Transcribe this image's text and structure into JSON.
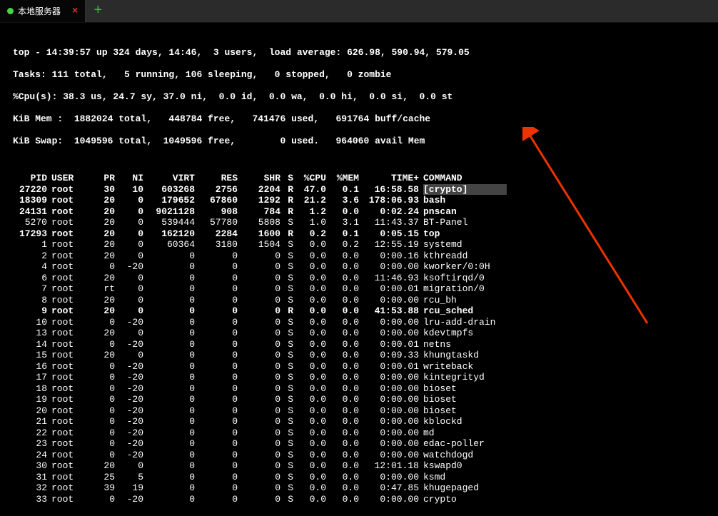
{
  "tab": {
    "title": "本地服务器",
    "close": "×",
    "add": "+"
  },
  "header": {
    "l1": "top - 14:39:57 up 324 days, 14:46,  3 users,  load average: 626.98, 590.94, 579.05",
    "l2": "Tasks: 111 total,   5 running, 106 sleeping,   0 stopped,   0 zombie",
    "l3": "%Cpu(s): 38.3 us, 24.7 sy, 37.0 ni,  0.0 id,  0.0 wa,  0.0 hi,  0.0 si,  0.0 st",
    "l4": "KiB Mem :  1882024 total,   448784 free,   741476 used,   691764 buff/cache",
    "l5": "KiB Swap:  1049596 total,  1049596 free,        0 used.   964060 avail Mem"
  },
  "cols": {
    "pid": "PID",
    "user": "USER",
    "pr": "PR",
    "ni": "NI",
    "virt": "VIRT",
    "res": "RES",
    "shr": "SHR",
    "s": "S",
    "cpu": "%CPU",
    "mem": "%MEM",
    "time": "TIME+",
    "cmd": "COMMAND"
  },
  "rows": [
    {
      "b": 1,
      "pid": "27220",
      "user": "root",
      "pr": "30",
      "ni": "10",
      "virt": "603268",
      "res": "2756",
      "shr": "2204",
      "s": "R",
      "cpu": "47.0",
      "mem": "0.1",
      "time": "16:58.58",
      "cmd": "[crypto]",
      "hl": 1
    },
    {
      "b": 1,
      "pid": "18309",
      "user": "root",
      "pr": "20",
      "ni": "0",
      "virt": "179652",
      "res": "67860",
      "shr": "1292",
      "s": "R",
      "cpu": "21.2",
      "mem": "3.6",
      "time": "178:06.93",
      "cmd": "bash"
    },
    {
      "b": 1,
      "pid": "24131",
      "user": "root",
      "pr": "20",
      "ni": "0",
      "virt": "9021128",
      "res": "908",
      "shr": "784",
      "s": "R",
      "cpu": "1.2",
      "mem": "0.0",
      "time": "0:02.24",
      "cmd": "pnscan"
    },
    {
      "b": 0,
      "pid": "5270",
      "user": "root",
      "pr": "20",
      "ni": "0",
      "virt": "539444",
      "res": "57780",
      "shr": "5808",
      "s": "S",
      "cpu": "1.0",
      "mem": "3.1",
      "time": "11:43.37",
      "cmd": "BT-Panel"
    },
    {
      "b": 1,
      "pid": "17293",
      "user": "root",
      "pr": "20",
      "ni": "0",
      "virt": "162120",
      "res": "2284",
      "shr": "1600",
      "s": "R",
      "cpu": "0.2",
      "mem": "0.1",
      "time": "0:05.15",
      "cmd": "top"
    },
    {
      "b": 0,
      "pid": "1",
      "user": "root",
      "pr": "20",
      "ni": "0",
      "virt": "60364",
      "res": "3180",
      "shr": "1504",
      "s": "S",
      "cpu": "0.0",
      "mem": "0.2",
      "time": "12:55.19",
      "cmd": "systemd"
    },
    {
      "b": 0,
      "pid": "2",
      "user": "root",
      "pr": "20",
      "ni": "0",
      "virt": "0",
      "res": "0",
      "shr": "0",
      "s": "S",
      "cpu": "0.0",
      "mem": "0.0",
      "time": "0:00.16",
      "cmd": "kthreadd"
    },
    {
      "b": 0,
      "pid": "4",
      "user": "root",
      "pr": "0",
      "ni": "-20",
      "virt": "0",
      "res": "0",
      "shr": "0",
      "s": "S",
      "cpu": "0.0",
      "mem": "0.0",
      "time": "0:00.00",
      "cmd": "kworker/0:0H"
    },
    {
      "b": 0,
      "pid": "6",
      "user": "root",
      "pr": "20",
      "ni": "0",
      "virt": "0",
      "res": "0",
      "shr": "0",
      "s": "S",
      "cpu": "0.0",
      "mem": "0.0",
      "time": "11:46.93",
      "cmd": "ksoftirqd/0"
    },
    {
      "b": 0,
      "pid": "7",
      "user": "root",
      "pr": "rt",
      "ni": "0",
      "virt": "0",
      "res": "0",
      "shr": "0",
      "s": "S",
      "cpu": "0.0",
      "mem": "0.0",
      "time": "0:00.01",
      "cmd": "migration/0"
    },
    {
      "b": 0,
      "pid": "8",
      "user": "root",
      "pr": "20",
      "ni": "0",
      "virt": "0",
      "res": "0",
      "shr": "0",
      "s": "S",
      "cpu": "0.0",
      "mem": "0.0",
      "time": "0:00.00",
      "cmd": "rcu_bh"
    },
    {
      "b": 1,
      "pid": "9",
      "user": "root",
      "pr": "20",
      "ni": "0",
      "virt": "0",
      "res": "0",
      "shr": "0",
      "s": "R",
      "cpu": "0.0",
      "mem": "0.0",
      "time": "41:53.88",
      "cmd": "rcu_sched"
    },
    {
      "b": 0,
      "pid": "10",
      "user": "root",
      "pr": "0",
      "ni": "-20",
      "virt": "0",
      "res": "0",
      "shr": "0",
      "s": "S",
      "cpu": "0.0",
      "mem": "0.0",
      "time": "0:00.00",
      "cmd": "lru-add-drain"
    },
    {
      "b": 0,
      "pid": "13",
      "user": "root",
      "pr": "20",
      "ni": "0",
      "virt": "0",
      "res": "0",
      "shr": "0",
      "s": "S",
      "cpu": "0.0",
      "mem": "0.0",
      "time": "0:00.00",
      "cmd": "kdevtmpfs"
    },
    {
      "b": 0,
      "pid": "14",
      "user": "root",
      "pr": "0",
      "ni": "-20",
      "virt": "0",
      "res": "0",
      "shr": "0",
      "s": "S",
      "cpu": "0.0",
      "mem": "0.0",
      "time": "0:00.01",
      "cmd": "netns"
    },
    {
      "b": 0,
      "pid": "15",
      "user": "root",
      "pr": "20",
      "ni": "0",
      "virt": "0",
      "res": "0",
      "shr": "0",
      "s": "S",
      "cpu": "0.0",
      "mem": "0.0",
      "time": "0:09.33",
      "cmd": "khungtaskd"
    },
    {
      "b": 0,
      "pid": "16",
      "user": "root",
      "pr": "0",
      "ni": "-20",
      "virt": "0",
      "res": "0",
      "shr": "0",
      "s": "S",
      "cpu": "0.0",
      "mem": "0.0",
      "time": "0:00.01",
      "cmd": "writeback"
    },
    {
      "b": 0,
      "pid": "17",
      "user": "root",
      "pr": "0",
      "ni": "-20",
      "virt": "0",
      "res": "0",
      "shr": "0",
      "s": "S",
      "cpu": "0.0",
      "mem": "0.0",
      "time": "0:00.00",
      "cmd": "kintegrityd"
    },
    {
      "b": 0,
      "pid": "18",
      "user": "root",
      "pr": "0",
      "ni": "-20",
      "virt": "0",
      "res": "0",
      "shr": "0",
      "s": "S",
      "cpu": "0.0",
      "mem": "0.0",
      "time": "0:00.00",
      "cmd": "bioset"
    },
    {
      "b": 0,
      "pid": "19",
      "user": "root",
      "pr": "0",
      "ni": "-20",
      "virt": "0",
      "res": "0",
      "shr": "0",
      "s": "S",
      "cpu": "0.0",
      "mem": "0.0",
      "time": "0:00.00",
      "cmd": "bioset"
    },
    {
      "b": 0,
      "pid": "20",
      "user": "root",
      "pr": "0",
      "ni": "-20",
      "virt": "0",
      "res": "0",
      "shr": "0",
      "s": "S",
      "cpu": "0.0",
      "mem": "0.0",
      "time": "0:00.00",
      "cmd": "bioset"
    },
    {
      "b": 0,
      "pid": "21",
      "user": "root",
      "pr": "0",
      "ni": "-20",
      "virt": "0",
      "res": "0",
      "shr": "0",
      "s": "S",
      "cpu": "0.0",
      "mem": "0.0",
      "time": "0:00.00",
      "cmd": "kblockd"
    },
    {
      "b": 0,
      "pid": "22",
      "user": "root",
      "pr": "0",
      "ni": "-20",
      "virt": "0",
      "res": "0",
      "shr": "0",
      "s": "S",
      "cpu": "0.0",
      "mem": "0.0",
      "time": "0:00.00",
      "cmd": "md"
    },
    {
      "b": 0,
      "pid": "23",
      "user": "root",
      "pr": "0",
      "ni": "-20",
      "virt": "0",
      "res": "0",
      "shr": "0",
      "s": "S",
      "cpu": "0.0",
      "mem": "0.0",
      "time": "0:00.00",
      "cmd": "edac-poller"
    },
    {
      "b": 0,
      "pid": "24",
      "user": "root",
      "pr": "0",
      "ni": "-20",
      "virt": "0",
      "res": "0",
      "shr": "0",
      "s": "S",
      "cpu": "0.0",
      "mem": "0.0",
      "time": "0:00.00",
      "cmd": "watchdogd"
    },
    {
      "b": 0,
      "pid": "30",
      "user": "root",
      "pr": "20",
      "ni": "0",
      "virt": "0",
      "res": "0",
      "shr": "0",
      "s": "S",
      "cpu": "0.0",
      "mem": "0.0",
      "time": "12:01.18",
      "cmd": "kswapd0"
    },
    {
      "b": 0,
      "pid": "31",
      "user": "root",
      "pr": "25",
      "ni": "5",
      "virt": "0",
      "res": "0",
      "shr": "0",
      "s": "S",
      "cpu": "0.0",
      "mem": "0.0",
      "time": "0:00.00",
      "cmd": "ksmd"
    },
    {
      "b": 0,
      "pid": "32",
      "user": "root",
      "pr": "39",
      "ni": "19",
      "virt": "0",
      "res": "0",
      "shr": "0",
      "s": "S",
      "cpu": "0.0",
      "mem": "0.0",
      "time": "0:47.85",
      "cmd": "khugepaged"
    },
    {
      "b": 0,
      "pid": "33",
      "user": "root",
      "pr": "0",
      "ni": "-20",
      "virt": "0",
      "res": "0",
      "shr": "0",
      "s": "S",
      "cpu": "0.0",
      "mem": "0.0",
      "time": "0:00.00",
      "cmd": "crypto"
    }
  ]
}
